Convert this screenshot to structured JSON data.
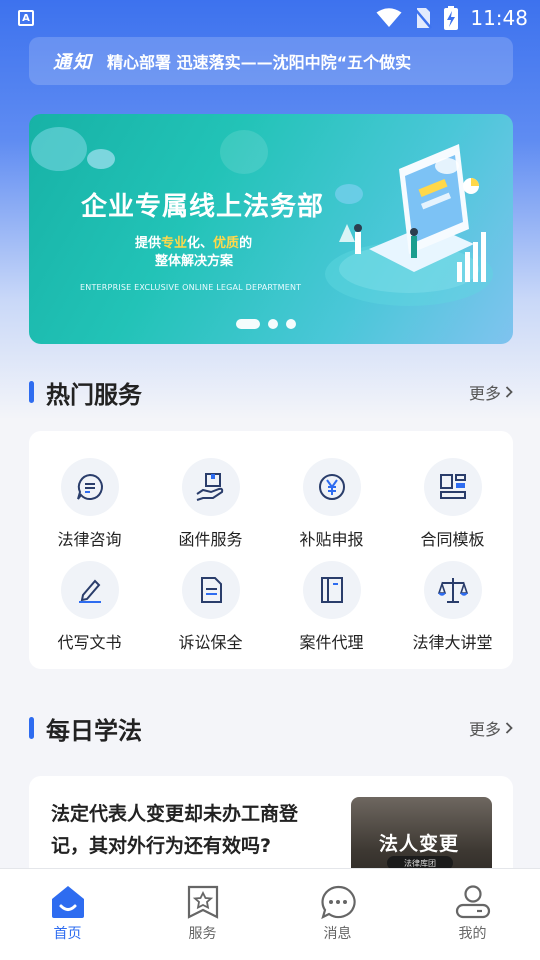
{
  "status_bar": {
    "time": "11:48",
    "app_icon_letter": "A"
  },
  "notice": {
    "tag": "通知",
    "text": "精心部署 迅速落实——沈阳中院“五个做实"
  },
  "banner": {
    "title": "企业专属线上法务部",
    "sub_line1_pre": "提供",
    "sub_line1_hl1": "专业",
    "sub_line1_mid": "化、",
    "sub_line1_hl2": "优质",
    "sub_line1_post": "的",
    "sub_line2": "整体解决方案",
    "english": "ENTERPRISE EXCLUSIVE ONLINE LEGAL DEPARTMENT",
    "page_count": 3,
    "active_page": 1
  },
  "hot_services": {
    "title": "热门服务",
    "more": "更多",
    "items": [
      {
        "label": "法律咨询",
        "icon": "chat-document-icon"
      },
      {
        "label": "函件服务",
        "icon": "hand-box-icon"
      },
      {
        "label": "补贴申报",
        "icon": "yen-icon"
      },
      {
        "label": "合同模板",
        "icon": "layout-template-icon"
      },
      {
        "label": "代写文书",
        "icon": "pencil-icon"
      },
      {
        "label": "诉讼保全",
        "icon": "file-icon"
      },
      {
        "label": "案件代理",
        "icon": "book-icon"
      },
      {
        "label": "法律大讲堂",
        "icon": "scales-icon"
      }
    ]
  },
  "daily_law": {
    "title": "每日学法",
    "more": "更多",
    "article": {
      "headline": "法定代表人变更却未办工商登记，其对外行为还有效吗?",
      "thumb_title": "法人变更",
      "thumb_sub": "法律库团"
    }
  },
  "tabbar": {
    "items": [
      {
        "label": "首页",
        "icon": "home-icon",
        "active": true
      },
      {
        "label": "服务",
        "icon": "star-bookmark-icon",
        "active": false
      },
      {
        "label": "消息",
        "icon": "message-icon",
        "active": false
      },
      {
        "label": "我的",
        "icon": "user-icon",
        "active": false
      }
    ]
  },
  "colors": {
    "accent": "#2e6cf0",
    "banner_teal": "#22c3b7",
    "highlight": "#ffd84a"
  }
}
